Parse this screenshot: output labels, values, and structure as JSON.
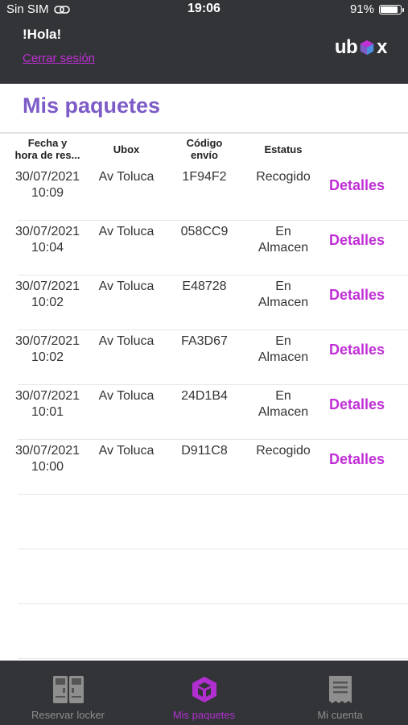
{
  "status_bar": {
    "carrier": "Sin SIM",
    "time": "19:06",
    "battery": "91%",
    "battery_level": 0.91
  },
  "header": {
    "greeting": "!Hola!",
    "logout_label": "Cerrar sesión",
    "logo_left": "ub",
    "logo_right": "x"
  },
  "page": {
    "title": "Mis paquetes"
  },
  "table": {
    "columns": [
      "Fecha y\nhora de res...",
      "Ubox",
      "Código\nenvío",
      "Estatus"
    ],
    "details_label": "Detalles",
    "rows": [
      {
        "fecha": "30/07/2021\n10:09",
        "ubox": "Av Toluca",
        "codigo": "1F94F2",
        "estatus": "Recogido"
      },
      {
        "fecha": "30/07/2021\n10:04",
        "ubox": "Av Toluca",
        "codigo": "058CC9",
        "estatus": "En\nAlmacen"
      },
      {
        "fecha": "30/07/2021\n10:02",
        "ubox": "Av Toluca",
        "codigo": "E48728",
        "estatus": "En\nAlmacen"
      },
      {
        "fecha": "30/07/2021\n10:02",
        "ubox": "Av Toluca",
        "codigo": "FA3D67",
        "estatus": "En\nAlmacen"
      },
      {
        "fecha": "30/07/2021\n10:01",
        "ubox": "Av Toluca",
        "codigo": "24D1B4",
        "estatus": "En\nAlmacen"
      },
      {
        "fecha": "30/07/2021\n10:00",
        "ubox": "Av Toluca",
        "codigo": "D911C8",
        "estatus": "Recogido"
      }
    ]
  },
  "tabbar": {
    "tabs": [
      {
        "label": "Reservar locker",
        "icon": "locker-icon",
        "active": false
      },
      {
        "label": "Mis paquetes",
        "icon": "package-icon",
        "active": true
      },
      {
        "label": "Mi cuenta",
        "icon": "receipt-icon",
        "active": false
      }
    ]
  },
  "colors": {
    "header_bg": "#333437",
    "accent": "#c02fd6",
    "title": "#7d5cc8"
  }
}
